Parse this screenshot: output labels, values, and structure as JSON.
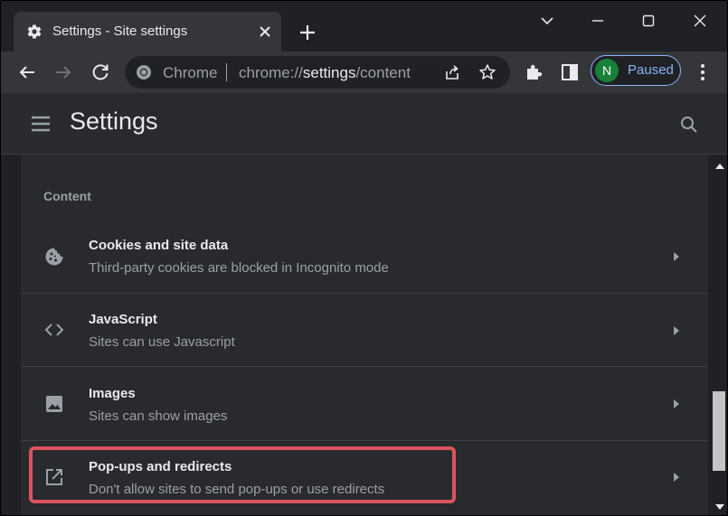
{
  "tab": {
    "title": "Settings - Site settings",
    "icon": "gear-icon"
  },
  "omnibox": {
    "site_label": "Chrome",
    "url_prefix": "chrome://",
    "url_path": "settings",
    "url_suffix": "/content"
  },
  "profile": {
    "initial": "N",
    "status": "Paused"
  },
  "header": {
    "title": "Settings"
  },
  "section": {
    "heading": "Content"
  },
  "rows": [
    {
      "title": "Cookies and site data",
      "subtitle": "Third-party cookies are blocked in Incognito mode",
      "icon": "cookie-icon"
    },
    {
      "title": "JavaScript",
      "subtitle": "Sites can use Javascript",
      "icon": "code-icon"
    },
    {
      "title": "Images",
      "subtitle": "Sites can show images",
      "icon": "image-icon"
    },
    {
      "title": "Pop-ups and redirects",
      "subtitle": "Don't allow sites to send pop-ups or use redirects",
      "icon": "open-in-new-icon",
      "highlighted": true
    }
  ],
  "colors": {
    "highlight": "#d9545f",
    "accent": "#8ab4f8",
    "avatar": "#188038"
  }
}
